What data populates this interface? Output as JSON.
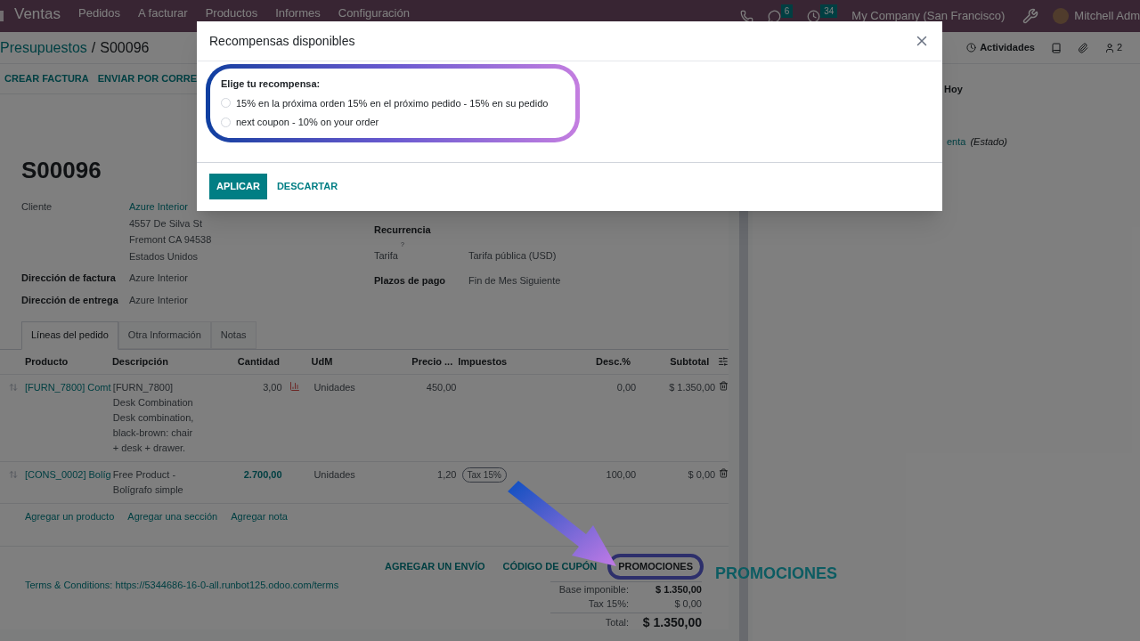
{
  "navbar": {
    "app": "Ventas",
    "menu": [
      "Pedidos",
      "A facturar",
      "Productos",
      "Informes",
      "Configuración"
    ],
    "messages_badge": "6",
    "activities_badge": "34",
    "company": "My Company (San Francisco)",
    "user": "Mitchell Adm"
  },
  "breadcrumb": {
    "parent": "Presupuestos",
    "separator": "/",
    "current": "S00096"
  },
  "actions": [
    "CREAR FACTURA",
    "ENVIAR POR CORRE"
  ],
  "chatter": {
    "activities": "Actividades",
    "followers": "2",
    "day": "Hoy",
    "tracking_value": "enta",
    "tracking_field": "(Estado)"
  },
  "form": {
    "title": "S00096",
    "left_fields": [
      {
        "label": "Cliente",
        "lines": [
          "Azure Interior",
          "4557 De Silva St",
          "Fremont CA 94538",
          "Estados Unidos"
        ]
      },
      {
        "label": "Dirección de factura",
        "lines": [
          "Azure Interior"
        ]
      },
      {
        "label": "Dirección de entrega",
        "lines": [
          "Azure Interior"
        ]
      }
    ],
    "right_fields": [
      {
        "label": "Recurrencia"
      },
      {
        "label": "Tarifa",
        "help": "?",
        "value": "Tarifa pública (USD)"
      },
      {
        "label": "Plazos de pago",
        "value": "Fin de Mes Siguiente"
      }
    ]
  },
  "tabs": [
    {
      "label": "Líneas del pedido",
      "selected": true
    },
    {
      "label": "Otra Información",
      "selected": false
    },
    {
      "label": "Notas",
      "selected": false
    }
  ],
  "table": {
    "columns": [
      "Producto",
      "Descripción",
      "Cantidad",
      "UdM",
      "Precio ...",
      "Impuestos",
      "Desc.%",
      "Subtotal"
    ],
    "rows": [
      {
        "product": "[FURN_7800] Comt",
        "description": [
          "[FURN_7800]",
          "Desk Combination",
          "Desk combination,",
          "black-brown: chair",
          "+ desk + drawer."
        ],
        "quantity": "3,00",
        "quantity_link": false,
        "forecast_icon": true,
        "uom": "Unidades",
        "price": "450,00",
        "taxes": [],
        "discount": "0,00",
        "subtotal": "$ 1.350,00"
      },
      {
        "product": "[CONS_0002] Bolíg",
        "description": [
          "Free Product -",
          "Bolígrafo simple"
        ],
        "quantity": "2.700,00",
        "quantity_link": true,
        "forecast_icon": false,
        "uom": "Unidades",
        "price": "1,20",
        "taxes": [
          "Tax 15%"
        ],
        "discount": "100,00",
        "subtotal": "$ 0,00"
      }
    ],
    "add_links": [
      "Agregar un producto",
      "Agregar una sección",
      "Agregar nota"
    ]
  },
  "footer_buttons": [
    {
      "label": "AGREGAR UN ENVÍO",
      "highlighted": false
    },
    {
      "label": "CÓDIGO DE CUPÓN",
      "highlighted": false
    },
    {
      "label": "PROMOCIONES",
      "highlighted": true
    }
  ],
  "annotation": {
    "label": "PROMOCIONES"
  },
  "terms": "Terms & Conditions: https://5344686-16-0-all.runbot125.odoo.com/terms",
  "totals": [
    {
      "label": "Base imponible:",
      "value": "$ 1.350,00",
      "grand": false
    },
    {
      "label": "Tax 15%:",
      "value": "$ 0,00",
      "grand": false
    },
    {
      "label": "Total:",
      "value": "$ 1.350,00",
      "grand": true
    }
  ],
  "dialog": {
    "title": "Recompensas disponibles",
    "prompt": "Elige tu recompensa:",
    "options": [
      {
        "label": "15% en la próxima orden 15% en el próximo pedido - 15% en su pedido",
        "selected": false
      },
      {
        "label": "next coupon - 10% on your order",
        "selected": false
      }
    ],
    "primary": "APLICAR",
    "secondary": "DESCARTAR"
  }
}
